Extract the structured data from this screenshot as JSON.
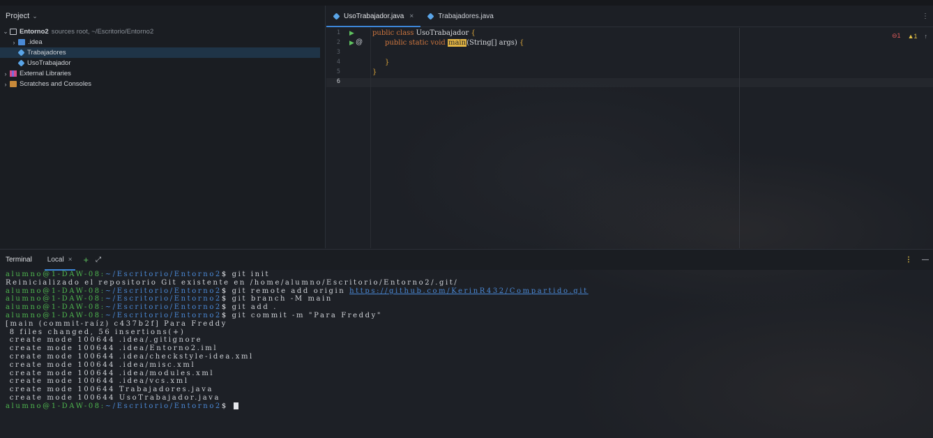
{
  "project": {
    "header": "Project",
    "tree": [
      {
        "name": "Entorno2",
        "detail": "sources root, ~/Escritorio/Entorno2",
        "icon": "folder-icon"
      },
      {
        "name": ".idea",
        "icon": "idea-folder-icon"
      },
      {
        "name": "Trabajadores",
        "icon": "java-class-icon"
      },
      {
        "name": "UsoTrabajador",
        "icon": "java-class-icon"
      },
      {
        "name": "External Libraries",
        "icon": "libraries-icon"
      },
      {
        "name": "Scratches and Consoles",
        "icon": "scratches-icon"
      }
    ]
  },
  "editor": {
    "tabs": [
      {
        "label": "UsoTrabajador.java",
        "close": "×"
      },
      {
        "label": "Trabajadores.java"
      }
    ],
    "line_numbers": [
      "1",
      "2",
      "3",
      "4",
      "5",
      "6"
    ],
    "code": {
      "l1_kw": "public class ",
      "l1_name": "UsoTrabajador ",
      "l1_brace": "{",
      "l2_kw": "public static void ",
      "l2_fn": "main",
      "l2_rest": "(String[] args) ",
      "l2_brace": "{",
      "l4_brace": "}",
      "l5_brace": "}"
    },
    "inspections": {
      "errors": "1",
      "warnings": "1"
    }
  },
  "terminal": {
    "title": "Terminal",
    "tab": "Local",
    "tab_close": "×",
    "prompt_user": "alumno@1-DAW-08:",
    "prompt_path": "~/Escritorio/Entorno2",
    "prompt_dollar": "$ ",
    "lines": {
      "c1": "git init",
      "o1": "Reinicializado el repositorio Git existente en /home/alumno/Escritorio/Entorno2/.git/",
      "c2": "git remote add origin ",
      "c2_url": "https://github.com/KerinR432/Compartido.git",
      "c3": "git branch -M main",
      "c4": "git add .",
      "c5": "git commit -m \"Para Freddy\"",
      "o2": "[main (commit-raíz) c437b2f] Para Freddy",
      "o3": " 8 files changed, 56 insertions(+)",
      "o4": " create mode 100644 .idea/.gitignore",
      "o5": " create mode 100644 .idea/Entorno2.iml",
      "o6": " create mode 100644 .idea/checkstyle-idea.xml",
      "o7": " create mode 100644 .idea/misc.xml",
      "o8": " create mode 100644 .idea/modules.xml",
      "o9": " create mode 100644 .idea/vcs.xml",
      "o10": " create mode 100644 Trabajadores.java",
      "o11": " create mode 100644 UsoTrabajador.java"
    }
  }
}
